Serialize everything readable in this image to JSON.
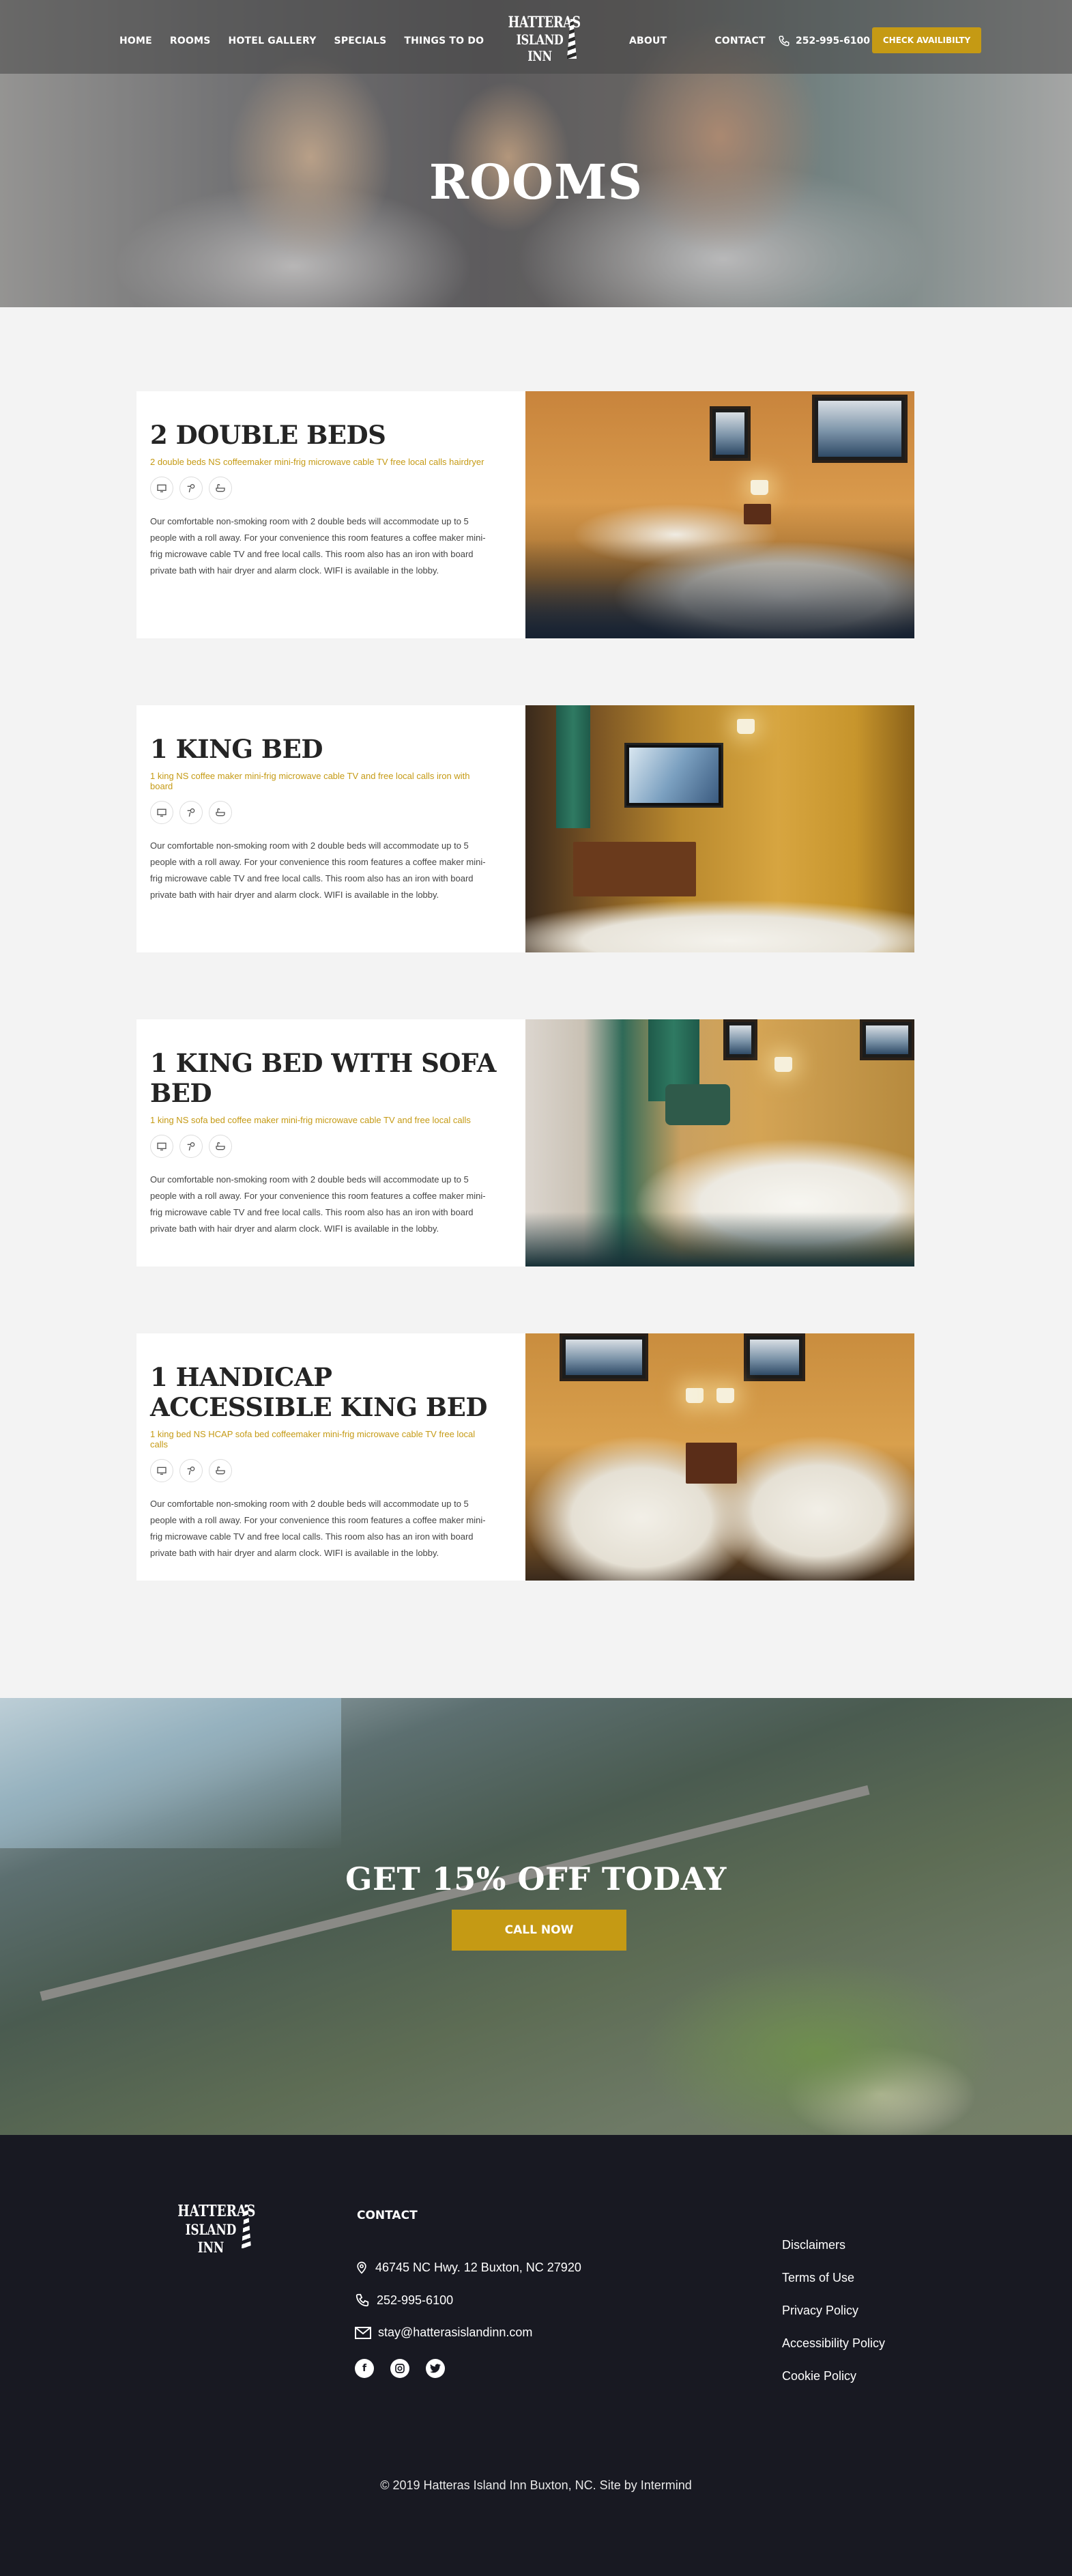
{
  "header": {
    "nav_left": [
      "HOME",
      "ROOMS",
      "HOTEL GALLERY",
      "SPECIALS",
      "THINGS TO DO"
    ],
    "nav_right": [
      "ABOUT",
      "CONTACT"
    ],
    "logo_line1": "HATTERAS",
    "logo_line2": "ISLAND INN",
    "phone": "252-995-6100",
    "cta": "CHECK AVAILIBILTY"
  },
  "hero": {
    "title": "ROOMS"
  },
  "rooms": [
    {
      "title": "2 DOUBLE BEDS",
      "amenities_line": "2 double beds NS coffeemaker mini-frig microwave cable TV free local calls hairdryer",
      "amenity_icons": [
        "tv-icon",
        "hairdryer-icon",
        "bathtub-icon"
      ],
      "description": "Our comfortable non-smoking room with 2 double beds will accommodate up to 5 people with a roll away. For your convenience this room features a coffee maker mini-frig microwave cable TV and free local calls. This room also has an iron with board private bath with hair dryer and alarm clock. WIFI is available in the lobby."
    },
    {
      "title": "1 KING BED",
      "amenities_line": "1 king NS coffee maker mini-frig microwave cable TV and free local calls iron with board",
      "amenity_icons": [
        "tv-icon",
        "hairdryer-icon",
        "bathtub-icon"
      ],
      "description": "Our comfortable non-smoking room with 2 double beds will accommodate up to 5 people with a roll away. For your convenience this room features a coffee maker mini-frig microwave cable TV and free local calls. This room also has an iron with board private bath with hair dryer and alarm clock. WIFI is available in the lobby."
    },
    {
      "title": "1 KING BED WITH SOFA BED",
      "amenities_line": "1 king NS sofa bed coffee maker mini-frig microwave cable TV and free local calls",
      "amenity_icons": [
        "tv-icon",
        "hairdryer-icon",
        "bathtub-icon"
      ],
      "description": "Our comfortable non-smoking room with 2 double beds will accommodate up to 5 people with a roll away. For your convenience this room features a coffee maker mini-frig microwave cable TV and free local calls. This room also has an iron with board private bath with hair dryer and alarm clock. WIFI is available in the lobby."
    },
    {
      "title": "1 HANDICAP ACCESSIBLE KING BED",
      "amenities_line": "1 king bed NS HCAP sofa bed coffeemaker mini-frig microwave cable TV free local calls",
      "amenity_icons": [
        "tv-icon",
        "hairdryer-icon",
        "bathtub-icon"
      ],
      "description": "Our comfortable non-smoking room with 2 double beds will accommodate up to 5 people with a roll away. For your convenience this room features a coffee maker mini-frig microwave cable TV and free local calls. This room also has an iron with board private bath with hair dryer and alarm clock. WIFI is available in the lobby."
    }
  ],
  "promo": {
    "title": "GET 15% OFF TODAY",
    "button": "CALL NOW"
  },
  "footer": {
    "logo_line1": "HATTERAS",
    "logo_line2": "ISLAND INN",
    "contact_heading": "CONTACT",
    "address": "46745 NC Hwy. 12 Buxton, NC 27920",
    "phone": "252-995-6100",
    "email": "stay@hatterasislandinn.com",
    "social": [
      "facebook-icon",
      "instagram-icon",
      "twitter-icon"
    ],
    "links": [
      "Disclaimers",
      "Terms of Use",
      "Privacy Policy",
      "Accessibility Policy",
      "Cookie Policy"
    ],
    "copyright": "© 2019 Hatteras Island Inn Buxton, NC. Site by Intermind"
  },
  "colors": {
    "accent": "#c59a14",
    "footer_bg": "#181922",
    "page_bg": "#f3f3f3"
  }
}
